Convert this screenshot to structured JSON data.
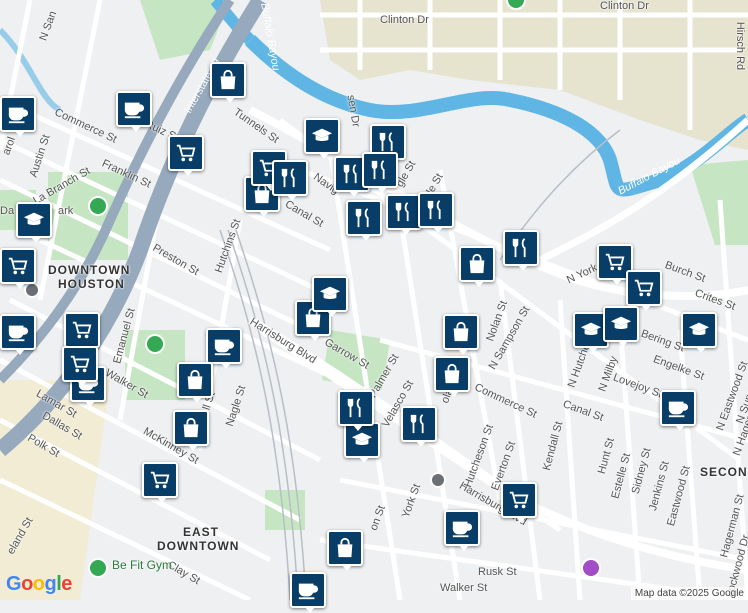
{
  "map": {
    "copyright": "Map data ©2025 Google",
    "logo_text": "Google",
    "colors": {
      "water": "#5fb6e4",
      "park": "#c6e6c3",
      "highway": "#96a9bd",
      "road": "#ffffff",
      "land": "#eef0f2",
      "campus": "#e3e0cc"
    }
  },
  "labels": {
    "downtown": "DOWNTOWN",
    "houston": "HOUSTON",
    "east": "EAST",
    "east_downtown": "DOWNTOWN",
    "buffalo_bayou_1": "Buffalo Bayou",
    "buffalo_bayou_2": "Buffalo Bayou",
    "interstate": "Interstate 69",
    "clinton_dr": "Clinton Dr",
    "clinton_dr2": "Clinton Dr",
    "hirsch_rd": "Hirsch Rd",
    "commerce_st": "Commerce St",
    "commerce_st2": "Commerce St",
    "franklin_st": "Franklin St",
    "austin_st": "Austin St",
    "la_branch": "La Branch St",
    "tunnels_st": "Tunnels St",
    "ruiz_st": "Ruiz St",
    "preston_st": "Preston St",
    "hutchins_st": "Hutchins St",
    "navigation": "Navig",
    "canal_st": "Canal St",
    "canal_st2": "Canal St",
    "harrisburg": "Harrisburg Blvd",
    "harrisburg2": "Harrisburg Blvd",
    "garrow_st": "Garrow St",
    "palmer_st": "Palmer St",
    "velasco_st": "Velasco St",
    "nolan_st": "Nolan St",
    "n_sampson": "N Sampson St",
    "n_york": "N York",
    "burch_st": "Burch St",
    "crites_st": "Crites St",
    "n_hutcheson": "N Hutcheson St",
    "n_milby": "N Milby",
    "bering_st": "Bering St",
    "engelke_st": "Engelke St",
    "lovejoy_st": "Lovejoy St",
    "n_eastwood": "N Eastwood St",
    "n_super": "N Super St",
    "n_hagerman": "N Hagerman",
    "hutcheson_st": "Hutcheson St",
    "everton_st": "Everton St",
    "york_st": "York St",
    "kendall_st": "Kendall St",
    "hunt_st": "Hunt St",
    "estelle_st": "Estelle St",
    "sidney_st": "Sidney St",
    "jenkins_st": "Jenkins St",
    "eastwood_st": "Eastwood St",
    "hagerman_st": "Hagerman St",
    "lockwood_dr": "Lockwood Dr",
    "emanuel_st": "Emanuel St",
    "walker_st": "Walker St",
    "walker_st2": "Walker St",
    "lamar_st": "Lamar St",
    "dallas_st": "Dallas St",
    "polk_st": "Polk St",
    "mckinney_st": "McKinney St",
    "nagle_st": "Nagle St",
    "clay_st": "Clay St",
    "rusk_st": "Rusk St",
    "cleland_st": "eland St",
    "be_fit_gym": "Be Fit Gym",
    "second": "SECON",
    "n_st_name": "N San",
    "ola_st": "ola",
    "daik": "Da",
    "park": "ark",
    "s_sen_dr": "sen Dr",
    "gle_st": "gle St",
    "le_st": "le St",
    "rol": "arol",
    "on_st": "on St",
    "ll_st": "ll St"
  },
  "pins": [
    {
      "type": "cafe-icon",
      "name": "cafe-pin"
    },
    {
      "type": "cafe-icon",
      "name": "cafe-pin"
    },
    {
      "type": "shopping-bag-icon",
      "name": "shop-pin"
    },
    {
      "type": "shopping-cart-icon",
      "name": "grocery-pin"
    },
    {
      "type": "school-icon",
      "name": "school-pin"
    },
    {
      "type": "restaurant-icon",
      "name": "restaurant-pin"
    }
  ]
}
